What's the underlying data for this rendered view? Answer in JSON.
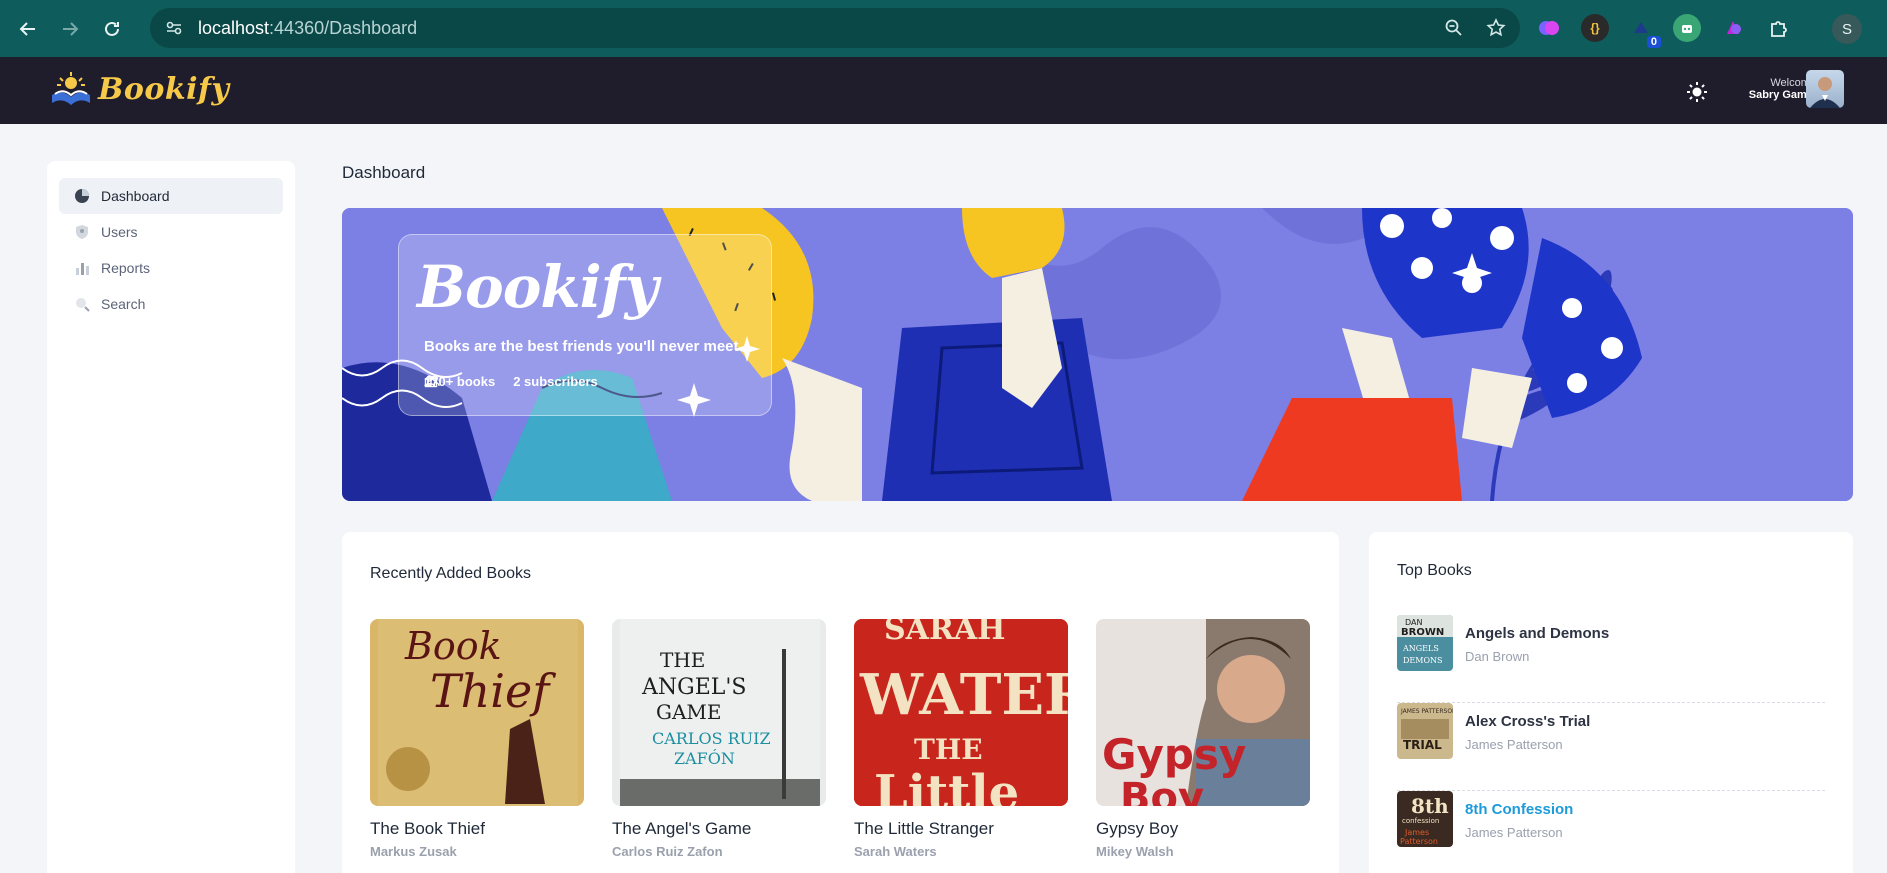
{
  "browser": {
    "url_host": "localhost",
    "url_port_path": ":44360/Dashboard",
    "extension_badge": "0",
    "profile_initial": "S"
  },
  "header": {
    "logo_text": "Bookify",
    "welcome_label": "Welcome",
    "user_name": "Sabry Gamal"
  },
  "sidebar": {
    "items": [
      {
        "label": "Dashboard",
        "icon": "pie-chart-icon",
        "active": true
      },
      {
        "label": "Users",
        "icon": "shield-icon",
        "active": false
      },
      {
        "label": "Reports",
        "icon": "bar-chart-icon",
        "active": false
      },
      {
        "label": "Search",
        "icon": "search-icon",
        "active": false
      }
    ]
  },
  "main": {
    "page_title": "Dashboard",
    "hero": {
      "brand": "Bookify",
      "tagline": "Books are the best friends you'll never meet",
      "books_stat": "170+ books",
      "subscribers_stat": "2 subscribers"
    },
    "recent": {
      "title": "Recently Added Books",
      "books": [
        {
          "title": "The Book Thief",
          "author": "Markus Zusak",
          "cover_color": "#d9b668"
        },
        {
          "title": "The Angel's Game",
          "author": "Carlos Ruiz Zafon",
          "cover_color": "#e9ebea"
        },
        {
          "title": "The Little Stranger",
          "author": "Sarah Waters",
          "cover_color": "#c8261d"
        },
        {
          "title": "Gypsy Boy",
          "author": "Mikey Walsh",
          "cover_color": "#e6e1dc"
        }
      ]
    },
    "top": {
      "title": "Top Books",
      "books": [
        {
          "title": "Angels and Demons",
          "author": "Dan Brown",
          "thumb_color": "#4a8ea0"
        },
        {
          "title": "Alex Cross's Trial",
          "author": "James Patterson",
          "thumb_color": "#cbb98d"
        },
        {
          "title": "8th Confession",
          "author": "James Patterson",
          "thumb_color": "#3a2a22"
        }
      ]
    }
  },
  "colors": {
    "header_bg": "#1f1d2c",
    "brand_yellow": "#f7c948",
    "hero_bg": "#7c7fe4",
    "link_blue": "#1d9bd8"
  }
}
